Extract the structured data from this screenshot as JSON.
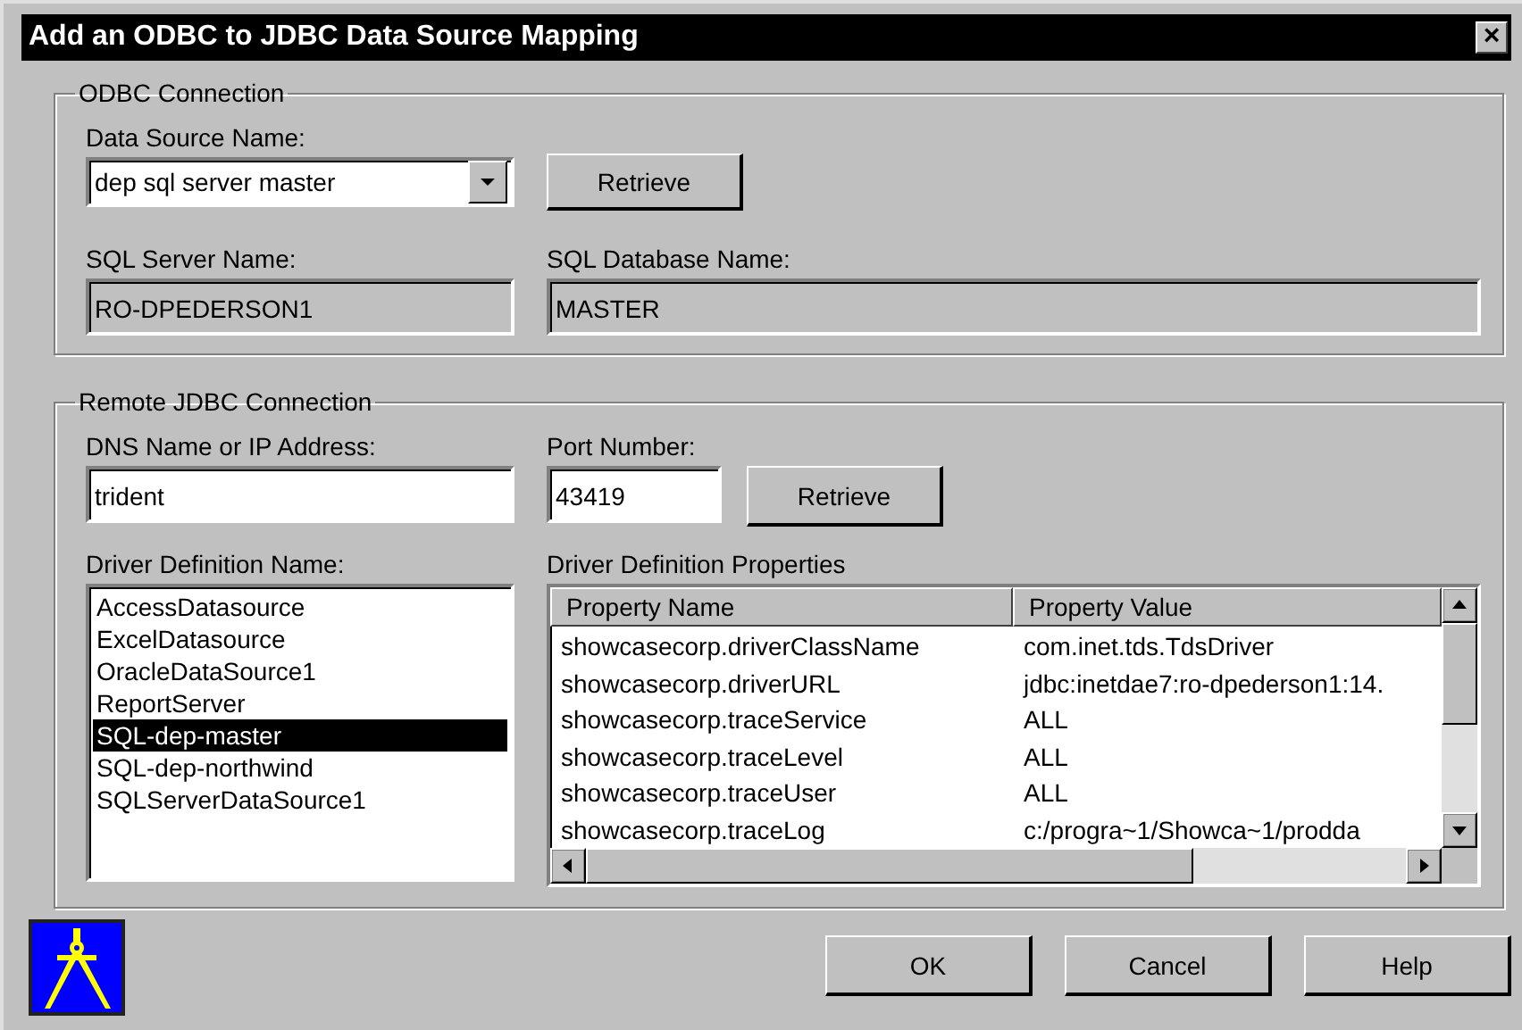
{
  "window": {
    "title": "Add an ODBC to JDBC Data Source Mapping",
    "close": "×"
  },
  "odbc": {
    "legend": "ODBC Connection",
    "data_source": {
      "label": "Data Source Name:",
      "value": "dep sql server master"
    },
    "retrieve": "Retrieve",
    "server": {
      "label": "SQL Server Name:",
      "value": "RO-DPEDERSON1",
      "disabled": true
    },
    "database": {
      "label": "SQL Database Name:",
      "value": "MASTER",
      "disabled": true
    }
  },
  "remote": {
    "legend": "Remote JDBC Connection",
    "dns": {
      "label": "DNS Name or IP Address:",
      "value": "trident"
    },
    "port": {
      "label": "Port Number:",
      "value": "43419"
    },
    "retrieve": "Retrieve",
    "drivers": {
      "label": "Driver Definition Name:",
      "items": [
        {
          "text": "AccessDatasource",
          "selected": false
        },
        {
          "text": "ExcelDatasource",
          "selected": false
        },
        {
          "text": "OracleDataSource1",
          "selected": false
        },
        {
          "text": "ReportServer",
          "selected": false
        },
        {
          "text": "SQL-dep-master",
          "selected": true
        },
        {
          "text": "SQL-dep-northwind",
          "selected": false
        },
        {
          "text": "SQLServerDataSource1",
          "selected": false
        }
      ]
    },
    "properties": {
      "label": "Driver Definition Properties",
      "columns": [
        "Property Name",
        "Property Value"
      ],
      "rows": [
        [
          "showcasecorp.driverClassName",
          "com.inet.tds.TdsDriver"
        ],
        [
          "showcasecorp.driverURL",
          "jdbc:inetdae7:ro-dpederson1:14."
        ],
        [
          "showcasecorp.traceService",
          "ALL"
        ],
        [
          "showcasecorp.traceLevel",
          "ALL"
        ],
        [
          "showcasecorp.traceUser",
          "ALL"
        ],
        [
          "showcasecorp.traceLog",
          "c:/progra~1/Showca~1/prodda"
        ]
      ]
    }
  },
  "buttons": [
    "OK",
    "Cancel",
    "Help"
  ]
}
